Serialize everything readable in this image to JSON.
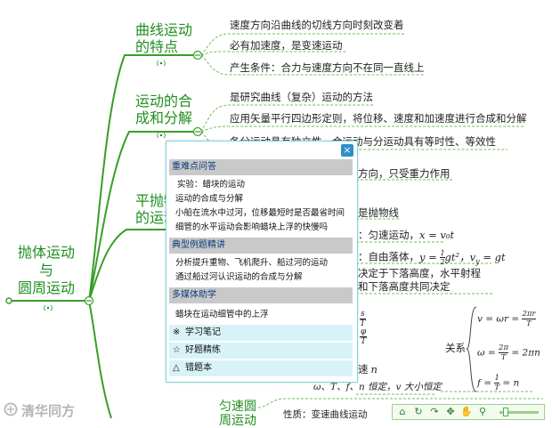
{
  "root": {
    "line1": "抛体运动",
    "line2": "与",
    "line3": "圆周运动"
  },
  "branches": {
    "quxian": {
      "line1": "曲线运动",
      "line2": "的特点",
      "leaves": [
        "速度方向沿曲线的切线方向时刻改变着",
        "必有加速度，是变速运动",
        "产生条件：合力与速度方向不在同一直线上"
      ]
    },
    "hecheng": {
      "line1": "运动的合",
      "line2": "成和分解",
      "leaves": [
        "是研究曲线（复杂）运动的方法",
        "应用矢量平行四边形定则，将位移、速度和加速度进行合成和分解",
        "各分运动具有独立性，合运动与分运动具有等时性、等效性"
      ]
    },
    "pingpao": {
      "line1": "平抛物",
      "line2": "的运动",
      "leaves": [
        "方向，只受重力作用",
        "是抛物线",
        "：匀速运动，",
        "：自由落体，",
        "决定于下落高度，水平射程",
        "和下落高度共同决定"
      ],
      "formulas": {
        "x": "x = v₀t",
        "y_left": "y = ",
        "y_num": "1",
        "y_den": "2",
        "y_right": "gt²",
        "vy": "v",
        "vy_sub": "y",
        "vy_right": " = gt"
      }
    },
    "yuanzhou": {
      "f1_num": "s",
      "f1_den": "T",
      "f2_num": "φ",
      "f2_den": "T",
      "left_mid": "速",
      "left_n": "n",
      "constant": "ω、T、f、n 恒定，v 大小恒定",
      "relation": "关系",
      "r1": "v = ωr = ",
      "r1_num": "2πr",
      "r1_den": "T",
      "r2": "ω = ",
      "r2_num": "2π",
      "r2_den": "T",
      "r2_right": " = 2πn",
      "r3": "f = ",
      "r3_num": "1",
      "r3_den": "T",
      "r3_right": " = n"
    },
    "yunsu": {
      "line1": "匀速圆",
      "line2": "周运动",
      "leaf": "性质：变速曲线运动"
    }
  },
  "popup": {
    "close": "×",
    "sections": [
      {
        "title": "重难点问答",
        "items": [
          "实验：蜡块的运动",
          "运动的合成与分解",
          "小船在流水中过河，位移最短时是否最省时间",
          "细管的水平运动会影响蜡块上浮的快慢吗"
        ]
      },
      {
        "title": "典型例题精讲",
        "items": [
          "分析提升重物、飞机爬升、船过河的运动",
          "通过船过河认识运动的合成与分解"
        ]
      },
      {
        "title": "多媒体助学",
        "items": [
          "蜡块在运动细管中的上浮"
        ]
      }
    ],
    "bottom": [
      {
        "icon": "※",
        "label": "学习笔记"
      },
      {
        "icon": "☆",
        "label": "好题精练"
      },
      {
        "icon": "△",
        "label": "错题本"
      }
    ]
  },
  "watermark": "清华同方",
  "colors": {
    "line": "#3a9d2a",
    "dash": "#6fbf5a",
    "node": "#1f8f1f",
    "popup_header": "#c9c9c9",
    "popup_bottom": "#d8f3f8"
  }
}
